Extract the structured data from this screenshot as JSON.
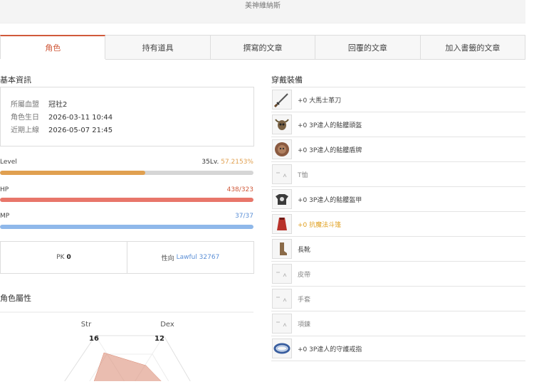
{
  "header": {
    "title": "美神維納斯"
  },
  "tabs": [
    {
      "label": "角色",
      "active": true
    },
    {
      "label": "持有道具"
    },
    {
      "label": "撰寫的文章"
    },
    {
      "label": "回覆的文章"
    },
    {
      "label": "加入書籤的文章"
    }
  ],
  "basic_info": {
    "title": "基本資訊",
    "rows": [
      {
        "label": "所屬血盟",
        "value": "冠社2"
      },
      {
        "label": "角色生日",
        "value": "2026-03-11 10:44"
      },
      {
        "label": "近期上線",
        "value": "2026-05-07 21:45"
      }
    ]
  },
  "stats": {
    "level": {
      "label": "Level",
      "value_prefix": "35Lv.",
      "value_pct": "57.2153%",
      "fraction": 0.572,
      "color": "#e0a050"
    },
    "hp": {
      "label": "HP",
      "value": "438/323",
      "fraction": 1.0,
      "color": "#e8766a",
      "text_color": "#d05a3b"
    },
    "mp": {
      "label": "MP",
      "value": "37/37",
      "fraction": 1.0,
      "color": "#8fb8ea",
      "text_color": "#5b8fd6"
    }
  },
  "pk": {
    "pk_label": "PK",
    "pk_value": "0",
    "alignment_label": "性向",
    "alignment_value": "Lawful 32767"
  },
  "attributes": {
    "title": "角色屬性",
    "str_label": "Str",
    "str_value": "16",
    "dex_label": "Dex",
    "dex_value": "12"
  },
  "equipment": {
    "title": "穿戴裝備",
    "items": [
      {
        "name": "+0 大馬士革刀",
        "icon": "dagger-icon"
      },
      {
        "name": "+0 3P達人的骷髏頭盔",
        "icon": "skull-helmet-icon"
      },
      {
        "name": "+0 3P達人的骷髏盾牌",
        "icon": "skull-shield-icon"
      },
      {
        "name": "T恤",
        "icon": "placeholder-icon"
      },
      {
        "name": "+0 3P達人的骷髏盔甲",
        "icon": "skull-armor-icon"
      },
      {
        "name": "+0 抗魔法斗篷",
        "icon": "cloak-icon",
        "color": "#e0a020"
      },
      {
        "name": "長靴",
        "icon": "boots-icon"
      },
      {
        "name": "皮帶",
        "icon": "placeholder-icon"
      },
      {
        "name": "手套",
        "icon": "placeholder-icon"
      },
      {
        "name": "項鍊",
        "icon": "placeholder-icon"
      },
      {
        "name": "+0 3P達人的守護戒指",
        "icon": "ring-icon"
      }
    ]
  }
}
